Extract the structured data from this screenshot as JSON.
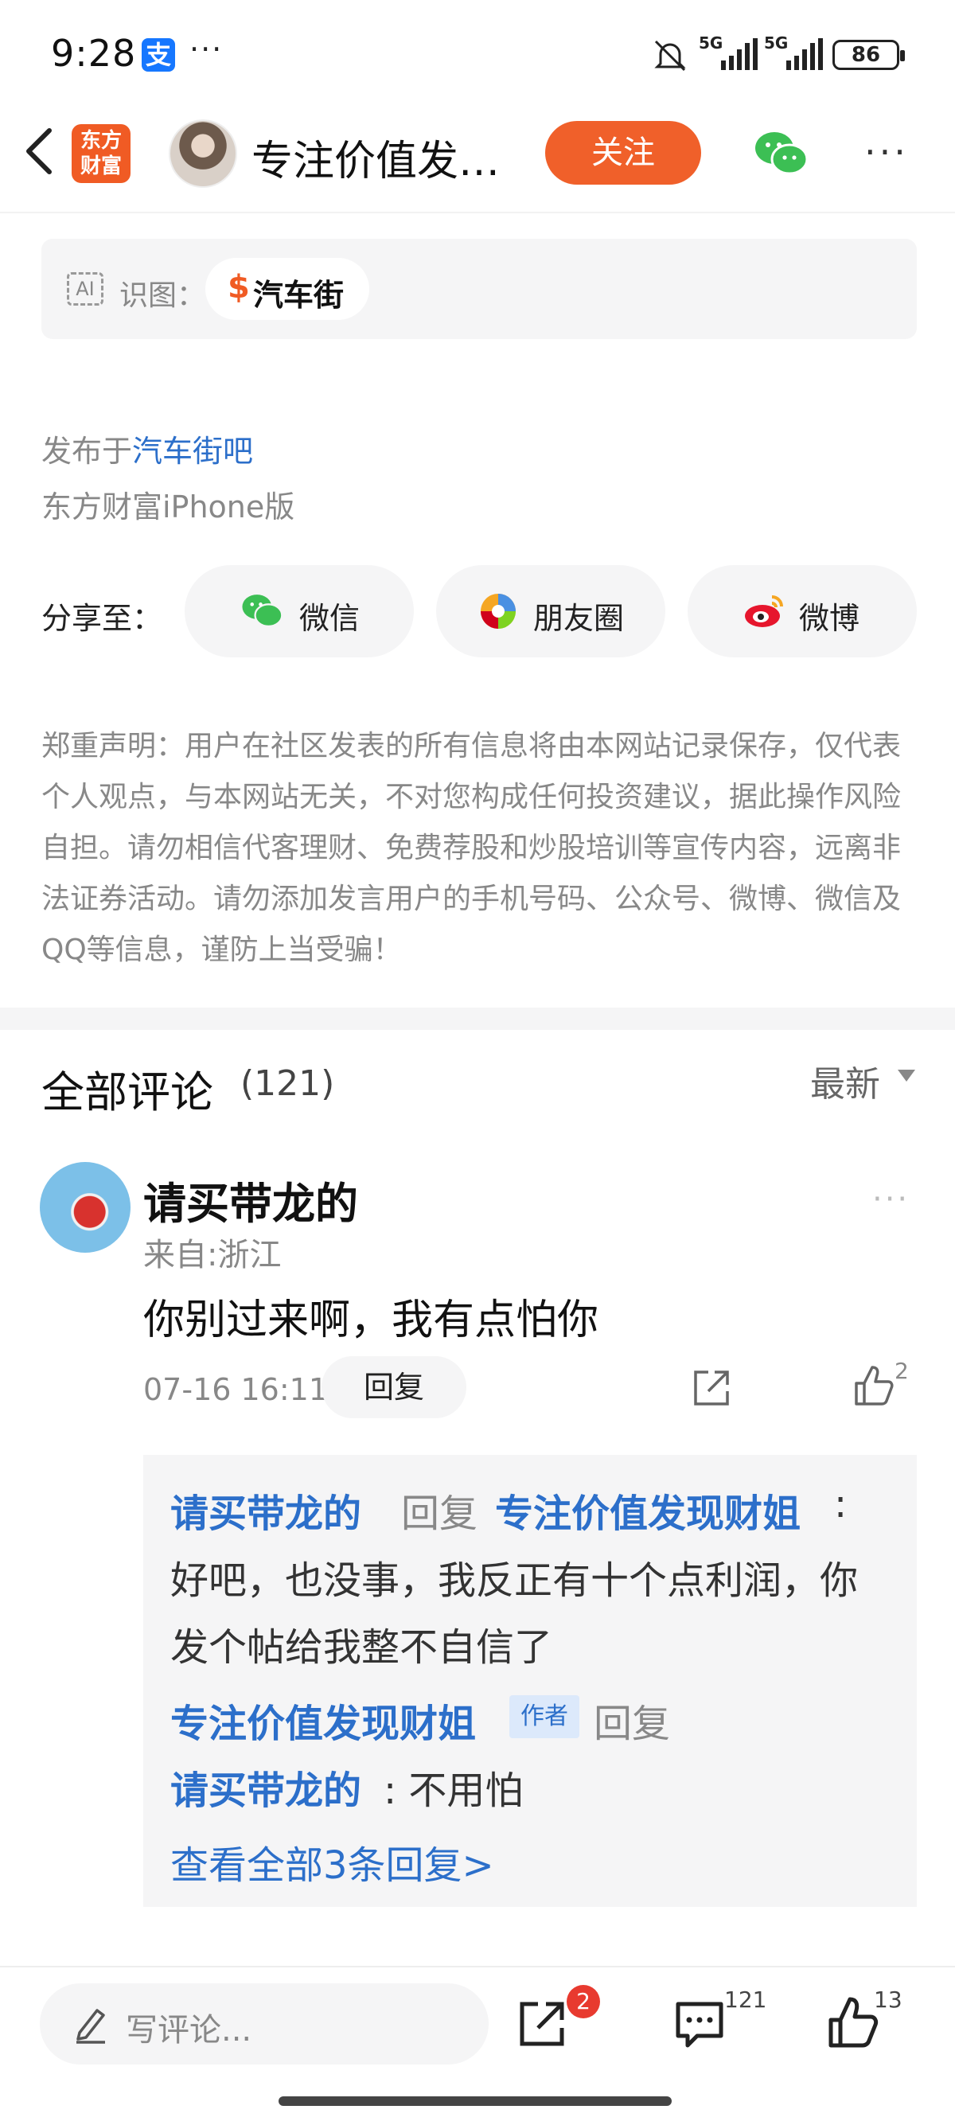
{
  "status_bar": {
    "time": "9:28",
    "alipay_glyph": "支",
    "more": "···",
    "network_1": "5G",
    "network_2": "5G",
    "battery": "86"
  },
  "header": {
    "logo_line1": "东方",
    "logo_line2": "财富",
    "author_name": "专注价值发…",
    "follow_label": "关注"
  },
  "ai_card": {
    "icon_text": "AI",
    "label": "识图：",
    "dollar": "$",
    "chip": "汽车街"
  },
  "publish": {
    "prefix": "发布于",
    "link": "汽车街吧",
    "device": "东方财富iPhone版"
  },
  "share": {
    "label": "分享至：",
    "items": [
      {
        "label": "微信"
      },
      {
        "label": "朋友圈"
      },
      {
        "label": "微博"
      }
    ]
  },
  "disclaimer": "郑重声明：用户在社区发表的所有信息将由本网站记录保存，仅代表个人观点，与本网站无关，不对您构成任何投资建议，据此操作风险自担。请勿相信代客理财、免费荐股和炒股培训等宣传内容，远离非法证券活动。请勿添加发言用户的手机号码、公众号、微博、微信及QQ等信息，谨防上当受骗！",
  "comments": {
    "title": "全部评论",
    "count": "(121)",
    "sort": "最新",
    "items": [
      {
        "user": "请买带龙的",
        "location": "来自:浙江",
        "text": "你别过来啊，我有点怕你",
        "time": "07-16 16:11",
        "reply_label": "回复",
        "likes": "2",
        "replies": {
          "r1_from": "请买带龙的",
          "r1_verb": "回复",
          "r1_to": "专注价值发现财姐",
          "r1_colon": ":",
          "r1_line1": "好吧，也没事，我反正有十个点利润，你",
          "r1_line2": "发个帖给我整不自信了",
          "r2_from": "专注价值发现财姐",
          "r2_tag": "作者",
          "r2_verb": "回复",
          "r2_to": "请买带龙的",
          "r2_text": ": 不用怕",
          "view_all": "查看全部3条回复>"
        }
      }
    ]
  },
  "bottom_bar": {
    "placeholder": "写评论...",
    "share_badge": "2",
    "comment_count": "121",
    "like_count": "13"
  },
  "colors": {
    "brand_orange": "#f0602a",
    "link_blue": "#2c6fca",
    "badge_red": "#e83a2f"
  }
}
